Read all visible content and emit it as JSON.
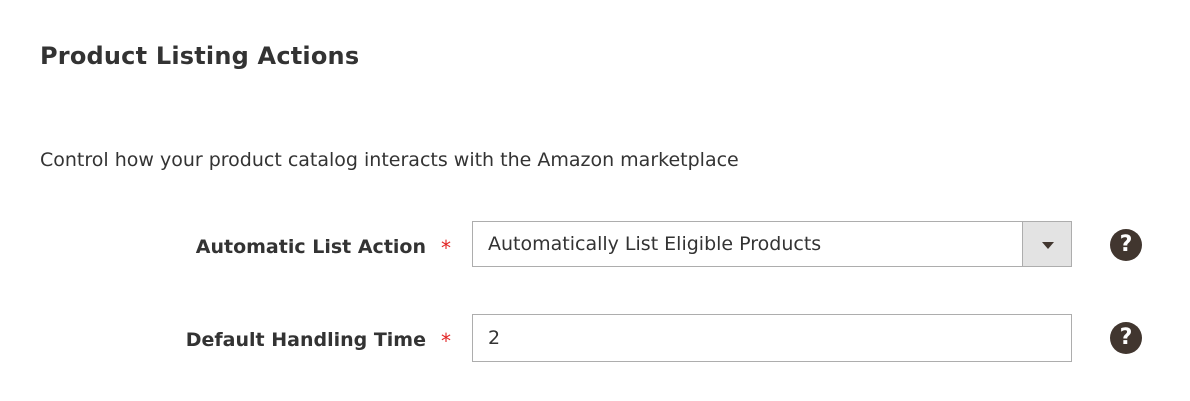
{
  "section": {
    "title": "Product Listing Actions",
    "description": "Control how your product catalog interacts with the Amazon marketplace"
  },
  "fields": {
    "automatic_list_action": {
      "label": "Automatic List Action",
      "required_marker": "*",
      "selected_value": "Automatically List Eligible Products",
      "help_icon": "question-circle-icon"
    },
    "default_handling_time": {
      "label": "Default Handling Time",
      "required_marker": "*",
      "value": "2",
      "help_icon": "question-circle-icon"
    }
  },
  "icons": {
    "help_glyph": "?",
    "dropdown_arrow": "chevron-down-icon"
  },
  "colors": {
    "text": "#333333",
    "required": "#e22626",
    "border": "#adadad",
    "select_arrow_bg": "#e3e3e3",
    "help_icon_bg": "#41362f"
  }
}
